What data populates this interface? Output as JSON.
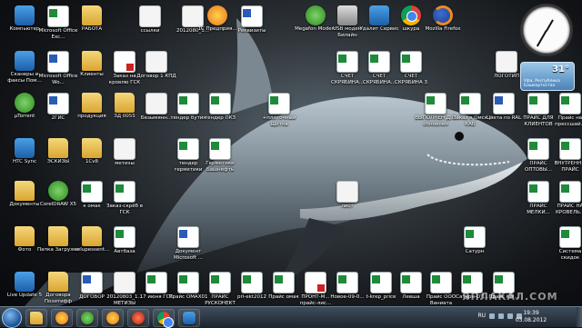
{
  "desktop": {
    "icons": [
      {
        "label": "Компьютер",
        "type": "app"
      },
      {
        "label": "Microsoft Office Exc...",
        "type": "excel"
      },
      {
        "label": "РАБОТА",
        "type": "folder"
      },
      {
        "label": "ссылки",
        "type": "doc"
      },
      {
        "label": "2012080_1...",
        "type": "doc"
      },
      {
        "label": "1С Предприя...",
        "type": "orange"
      },
      {
        "label": "Реквизиты",
        "type": "word"
      },
      {
        "label": "Megafon Modem",
        "type": "green"
      },
      {
        "label": "USB модем Билайн",
        "type": "gray"
      },
      {
        "label": "Удалит Сервис",
        "type": "app"
      },
      {
        "label": "шкура",
        "type": "chrome"
      },
      {
        "label": "Mozilla Firefox",
        "type": "firefox"
      },
      {
        "label": "Сканеры и факсы Пом...",
        "type": "app"
      },
      {
        "label": "Microsoft Office Wo...",
        "type": "word"
      },
      {
        "label": "Клиенты",
        "type": "folder"
      },
      {
        "label": "Заказ на кровлю ГСК",
        "type": "pdf"
      },
      {
        "label": "Договор 1 КПД",
        "type": "doc"
      },
      {
        "label": "СЧЕТ СКРЯБИНА...",
        "type": "excel"
      },
      {
        "label": "СЧЕТ СКРЯБИНА...",
        "type": "excel"
      },
      {
        "label": "СЧЕТ СКРЯБИНА 3",
        "type": "excel"
      },
      {
        "label": "ЛОГОТИП",
        "type": "doc"
      },
      {
        "label": "µTorrent",
        "type": "green"
      },
      {
        "label": "2ГИС",
        "type": "word"
      },
      {
        "label": "продукция",
        "type": "folder"
      },
      {
        "label": "ЗД 0055",
        "type": "folder"
      },
      {
        "label": "Безымянн...",
        "type": "doc"
      },
      {
        "label": "тендер бутик",
        "type": "excel"
      },
      {
        "label": "тендер ПКЗ",
        "type": "excel"
      },
      {
        "label": "+плиточный Щётка",
        "type": "excel"
      },
      {
        "label": "ВЫПОЛНЕН Д.Р. обновлен",
        "type": "excel"
      },
      {
        "label": "Заказ в Омск КАБ",
        "type": "excel"
      },
      {
        "label": "Цвета по RAL",
        "type": "word"
      },
      {
        "label": "ПРАЙС ДЛЯ КЛИЕНТОВ",
        "type": "excel"
      },
      {
        "label": "Прайс на прессшай...",
        "type": "excel"
      },
      {
        "label": "HTC Sync",
        "type": "app"
      },
      {
        "label": "ЭСКИЗЫ",
        "type": "folder"
      },
      {
        "label": "1Cv8",
        "type": "folder"
      },
      {
        "label": "метизы",
        "type": "doc"
      },
      {
        "label": "тендер герметики",
        "type": "excel"
      },
      {
        "label": "Герметики Башнефть",
        "type": "excel"
      },
      {
        "label": "ПРАЙС ОПТОВЫ...",
        "type": "excel"
      },
      {
        "label": "ВНУТРЕНН... ПРАЙС",
        "type": "excel"
      },
      {
        "label": "Документы",
        "type": "folder"
      },
      {
        "label": "CorelDRAW X5",
        "type": "green"
      },
      {
        "label": "к омак",
        "type": "excel"
      },
      {
        "label": "Заказ-скрёб в ГСК",
        "type": "excel"
      },
      {
        "label": "лист",
        "type": "doc"
      },
      {
        "label": "ПРАЙС МЕЛКИ...",
        "type": "excel"
      },
      {
        "label": "ПРАЙС НА КРОВЕЛЬ...",
        "type": "excel"
      },
      {
        "label": "Фото",
        "type": "folder"
      },
      {
        "label": "Папка Загрузки",
        "type": "folder"
      },
      {
        "label": "xelupessent...",
        "type": "folder"
      },
      {
        "label": "Автбаза",
        "type": "excel"
      },
      {
        "label": "Документ Microsoft ...",
        "type": "word"
      },
      {
        "label": "Сатурн",
        "type": "excel"
      },
      {
        "label": "Система скидок",
        "type": "excel"
      },
      {
        "label": "Live Update 5",
        "type": "app"
      },
      {
        "label": "Договора Позитифф",
        "type": "folder"
      },
      {
        "label": "ДОГОВОР",
        "type": "word"
      },
      {
        "label": "20120803_1... МЕТИЗЫ",
        "type": "doc"
      },
      {
        "label": "17 июня ГСК",
        "type": "excel"
      },
      {
        "label": "Прайс ОМАХ01",
        "type": "excel"
      },
      {
        "label": "ПРАЙС РУСКОНЕКТ",
        "type": "excel"
      },
      {
        "label": "prl-ekt2012",
        "type": "excel"
      },
      {
        "label": "Прайс омак",
        "type": "excel"
      },
      {
        "label": "ПРОНТ-М... прайс-лис...",
        "type": "pdf"
      },
      {
        "label": "Новое-09-0...",
        "type": "excel"
      },
      {
        "label": "t-krep_price",
        "type": "excel"
      },
      {
        "label": "Левша",
        "type": "excel"
      },
      {
        "label": "Прайс ООО Ваниата",
        "type": "excel"
      },
      {
        "label": "Сатурн-ОТ...",
        "type": "excel"
      },
      {
        "label": "Прайс КМ...",
        "type": "excel"
      }
    ]
  },
  "gadgets": {
    "weather_temp": "31°",
    "weather_city": "Уфа, Республика Башкортостан"
  },
  "taskbar": {
    "language": "RU",
    "time": "19:39",
    "date": "03.08.2012"
  },
  "watermark": "ЯПЛАКАЛ.COM"
}
